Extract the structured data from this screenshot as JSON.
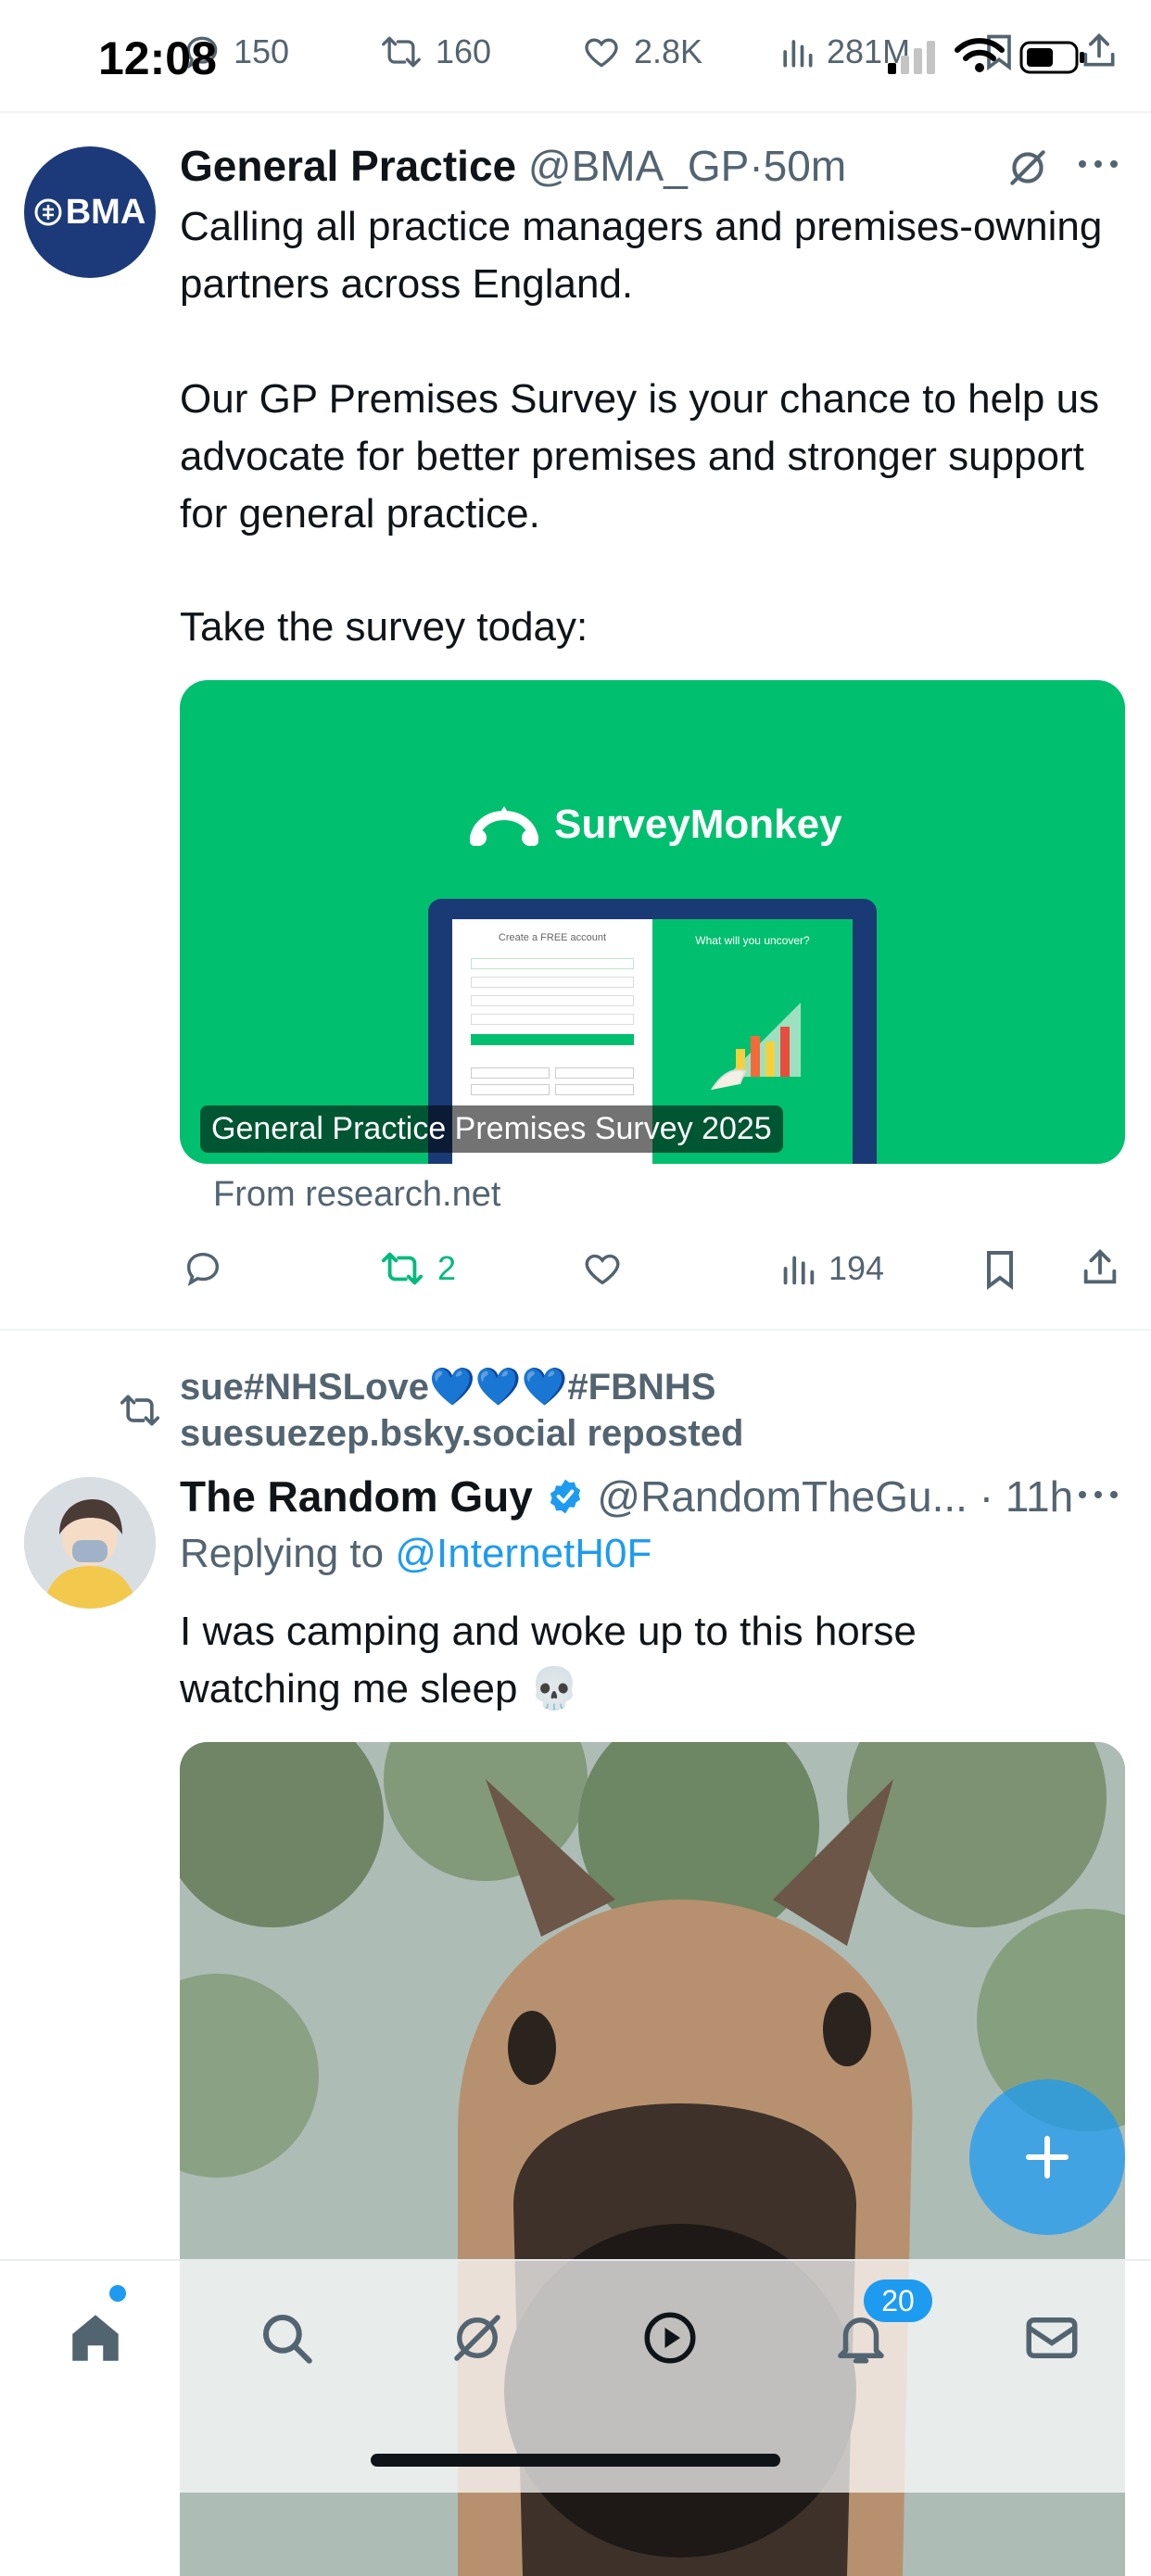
{
  "status_bar": {
    "time": "12:08"
  },
  "prev_tweet_actions": {
    "replies": "150",
    "reposts": "160",
    "likes": "2.8K",
    "views": "281M"
  },
  "tweet1": {
    "avatar_text": "BMA",
    "name": "General Practice",
    "handle": "@BMA_GP",
    "separator": "·",
    "time": "50m",
    "paragraphs": [
      "Calling all practice managers and premises-owning partners across England.",
      "Our GP Premises Survey is your chance to help us advocate for better premises and stronger support for general practice.",
      "Take the survey today:"
    ],
    "card": {
      "brand": "SurveyMonkey",
      "caption": "General Practice Premises Survey 2025",
      "laptop_left_heading": "Create a FREE account",
      "laptop_right_heading": "What will you uncover?"
    },
    "source": "From research.net",
    "reposts": "2",
    "views": "194"
  },
  "repost_header": {
    "line1": "sue#NHSLove💙💙💙#FBNHS",
    "line2": "suesuezep.bsky.social reposted"
  },
  "tweet2": {
    "name": "The Random Guy",
    "handle": "@RandomTheGu...",
    "separator": "·",
    "time": "11h",
    "replying_prefix": "Replying to",
    "replying_to": "@InternetH0F",
    "text_line1": "I was camping and woke up to this horse",
    "text_line2": "watching me sleep 💀"
  },
  "bottom_nav": {
    "notifications_badge": "20"
  },
  "colors": {
    "accent": "#1d9bf0",
    "repost_green": "#00ba7c",
    "survey_green": "#00bf6f",
    "text_secondary": "#536471"
  }
}
